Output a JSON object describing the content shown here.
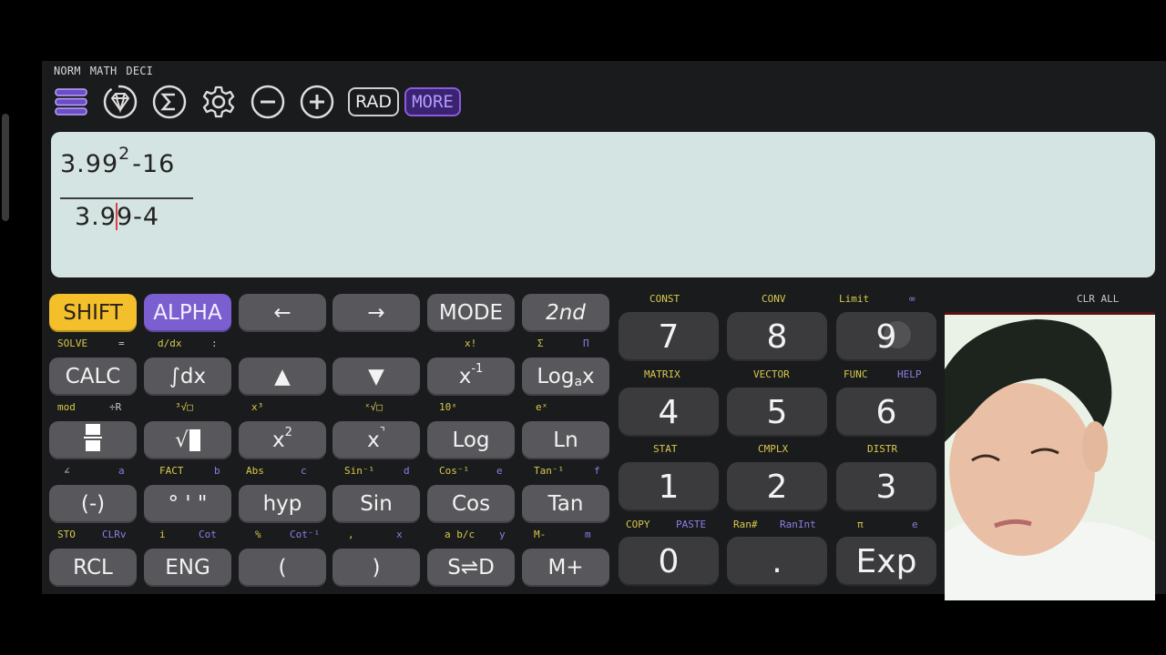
{
  "status": [
    "NORM",
    "MATH",
    "DECI"
  ],
  "toolbar": {
    "icons": [
      "menu-icon",
      "gem-icon",
      "sigma-icon",
      "gear-icon",
      "minus-circle-icon",
      "plus-circle-icon"
    ],
    "rad_label": "RAD",
    "more_label": "MORE"
  },
  "display": {
    "numerator_base": "3.99",
    "numerator_exp": "2",
    "numerator_rest": "-16",
    "denominator_a": "3.9",
    "denominator_b": "9-4"
  },
  "colors": {
    "shift": "#f3c02c",
    "alpha": "#7b5fd0",
    "display_bg": "#d4e4e2",
    "key_bg": "#58585c",
    "numkey_bg": "#3b3b3e"
  },
  "keys": {
    "row1": [
      "SHIFT",
      "ALPHA",
      "←",
      "→",
      "MODE",
      "2nd"
    ],
    "row2": [
      "CALC",
      "∫dx",
      "▲",
      "▼",
      "x",
      "Log"
    ],
    "row2_extra": {
      "inv_exp": "-1",
      "log_sub": "a",
      "log_x": "x"
    },
    "row3": [
      "",
      "√",
      "x",
      "x",
      "Log",
      "Ln"
    ],
    "row3_extra": {
      "sq_exp": "2",
      "cube_exp": "⌝"
    },
    "row4": [
      "(-)",
      "° ' \"",
      "hyp",
      "Sin",
      "Cos",
      "Tan"
    ],
    "row5": [
      "RCL",
      "ENG",
      "(",
      ")",
      "S⇌D",
      "M+"
    ]
  },
  "labels": {
    "row1": [
      [
        "SOLVE",
        "y"
      ],
      [
        "=",
        "w"
      ],
      [
        "d/dx",
        "y"
      ],
      [
        ":",
        "w"
      ],
      [
        "x!",
        "y"
      ],
      [
        "Σ",
        "y"
      ],
      [
        "Π",
        "p"
      ]
    ],
    "row2": [
      [
        "mod",
        "y"
      ],
      [
        "÷R",
        "w"
      ],
      [
        "³√□",
        "y"
      ],
      [
        "x³",
        "y"
      ],
      [
        "ˣ√□",
        "y"
      ],
      [
        "10ˣ",
        "y"
      ],
      [
        "eˣ",
        "y"
      ]
    ],
    "row3": [
      [
        "∠",
        "w"
      ],
      [
        "a",
        "p"
      ],
      [
        "FACT",
        "y"
      ],
      [
        "b",
        "p"
      ],
      [
        "Abs",
        "y"
      ],
      [
        "c",
        "p"
      ],
      [
        "Sin⁻¹",
        "y"
      ],
      [
        "d",
        "p"
      ],
      [
        "Cos⁻¹",
        "y"
      ],
      [
        "e",
        "p"
      ],
      [
        "Tan⁻¹",
        "y"
      ],
      [
        "f",
        "p"
      ]
    ],
    "row4": [
      [
        "STO",
        "y"
      ],
      [
        "CLRv",
        "p"
      ],
      [
        "i",
        "y"
      ],
      [
        "Cot",
        "p"
      ],
      [
        "%",
        "y"
      ],
      [
        "Cot⁻¹",
        "p"
      ],
      [
        ",",
        "y"
      ],
      [
        "x",
        "p"
      ],
      [
        "a b/c",
        "y"
      ],
      [
        "y",
        "p"
      ],
      [
        "M-",
        "y"
      ],
      [
        "m",
        "p"
      ]
    ]
  },
  "numpad": {
    "keys": [
      "7",
      "8",
      "9",
      "4",
      "5",
      "6",
      "1",
      "2",
      "3",
      "0",
      ".",
      "Exp"
    ],
    "labels_top": [
      "CONST",
      "CONV",
      "Limit",
      "∞"
    ],
    "labels_r2": [
      "MATRIX",
      "VECTOR",
      "FUNC",
      "HELP"
    ],
    "labels_r3": [
      "STAT",
      "CMPLX",
      "DISTR"
    ],
    "labels_r4": [
      "COPY",
      "PASTE",
      "Ran#",
      "RanInt",
      "π",
      "e"
    ],
    "clr_all": "CLR ALL"
  },
  "camera": {
    "description": "webcam overlay of presenter"
  }
}
